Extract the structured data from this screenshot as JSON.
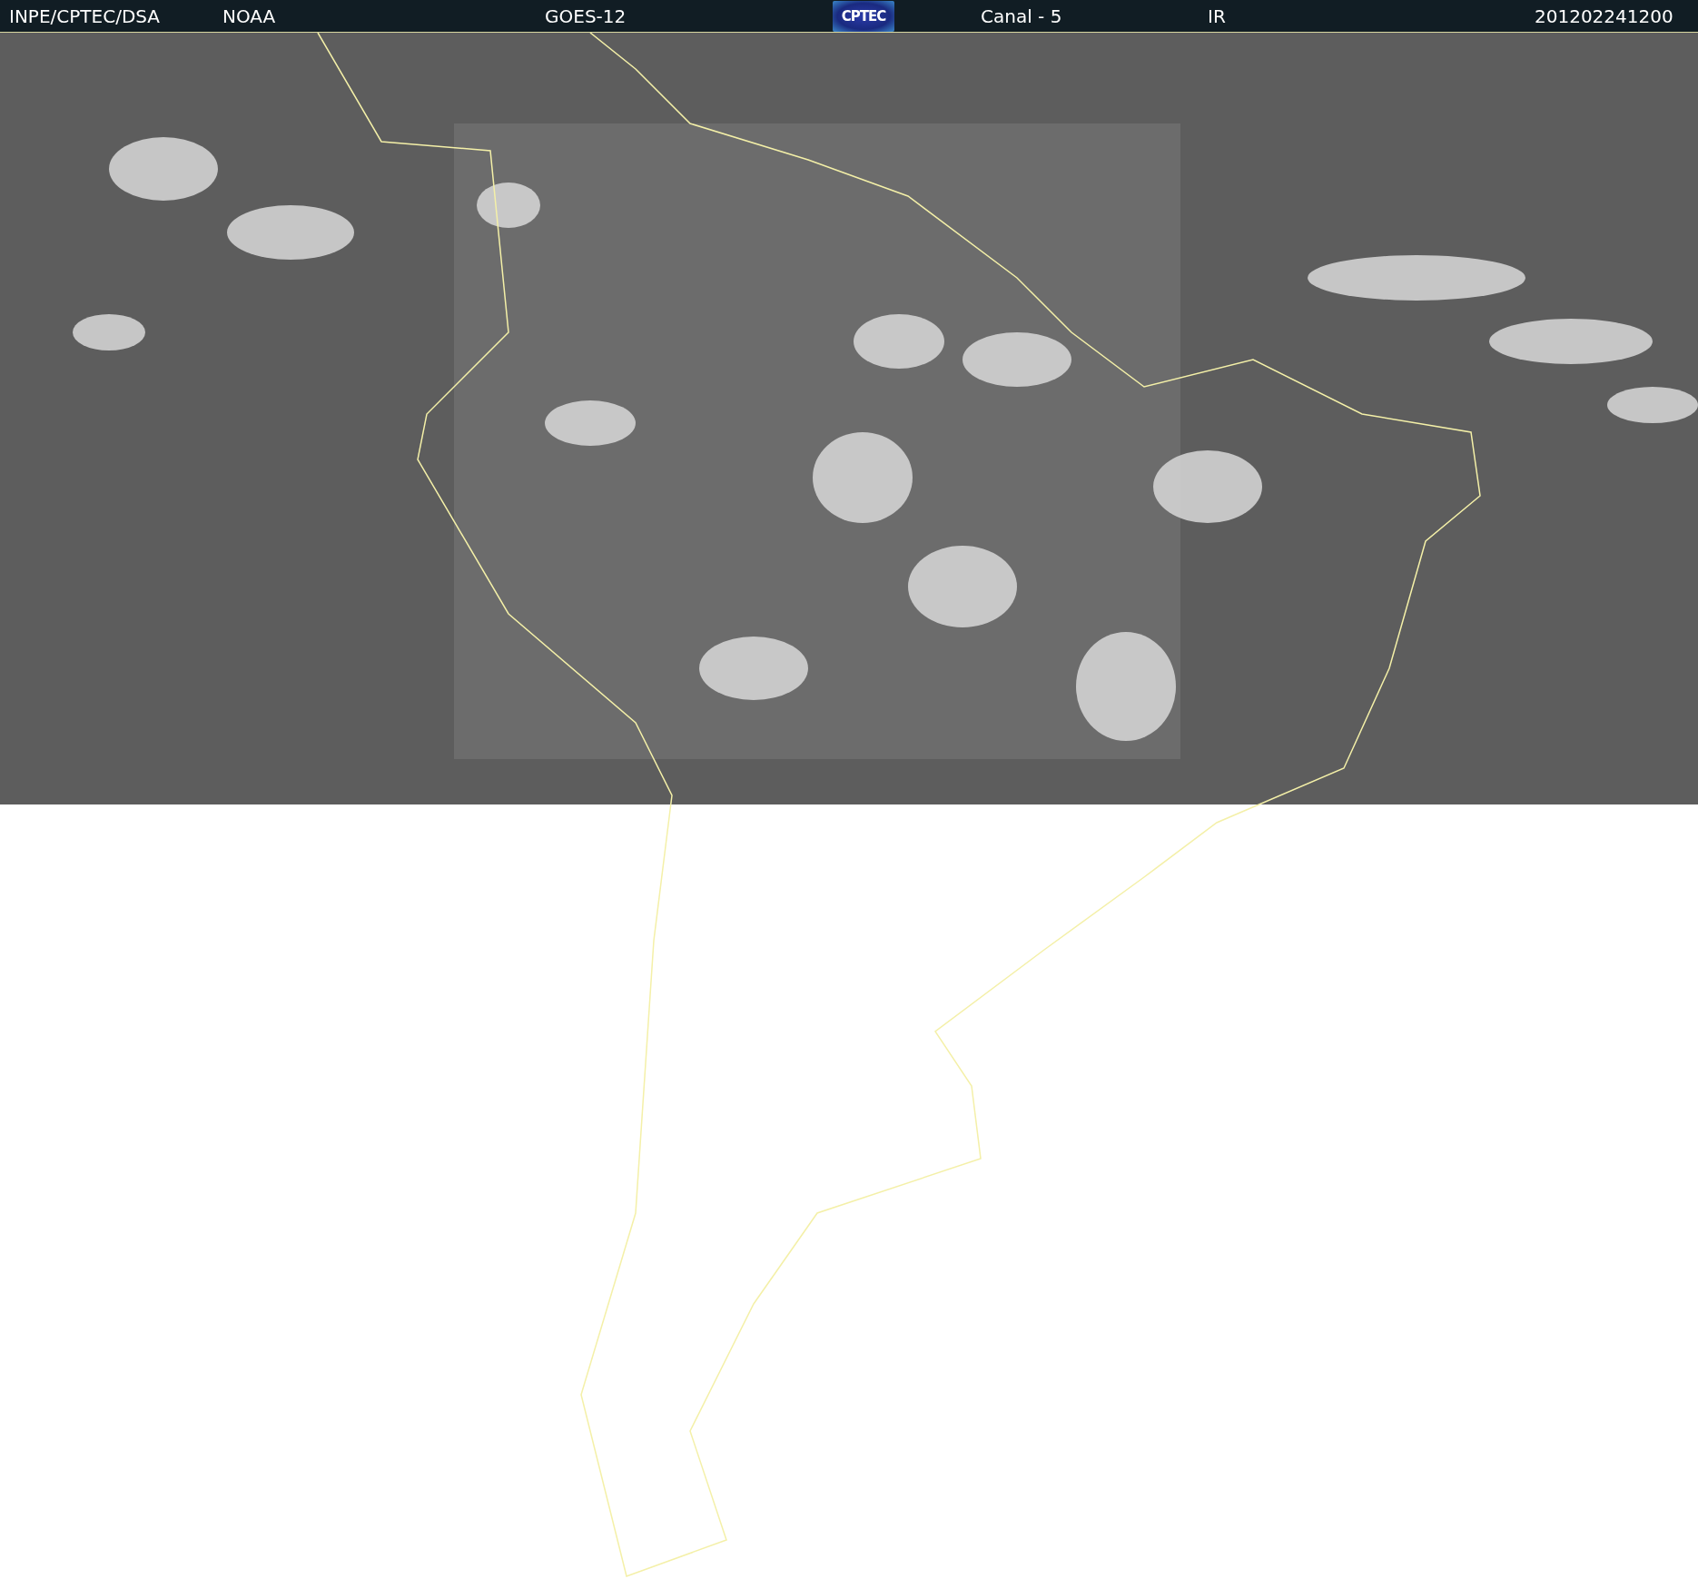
{
  "header": {
    "items": [
      {
        "kind": "text",
        "label": "INPE/CPTEC/DSA"
      },
      {
        "kind": "text",
        "label": "NOAA"
      },
      {
        "kind": "text",
        "label": "GOES-12"
      },
      {
        "kind": "logo",
        "label": "CPTEC"
      },
      {
        "kind": "text",
        "label": "Canal - 5"
      },
      {
        "kind": "text",
        "label": "IR"
      },
      {
        "kind": "text",
        "label": "201202241200"
      }
    ]
  }
}
